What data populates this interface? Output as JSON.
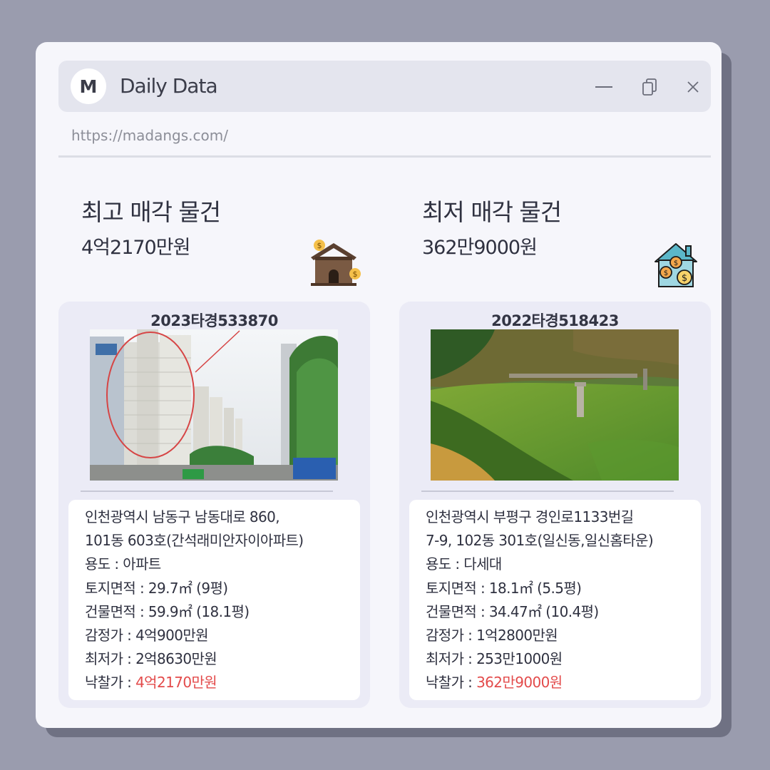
{
  "window": {
    "avatar_letter": "M",
    "title": "Daily Data",
    "url": "https://madangs.com/"
  },
  "highest": {
    "heading": "최고 매각 물건",
    "price": "4억2170만원",
    "icon": "house-money-icon",
    "case_no": "2023타경533870",
    "address_line1": "인천광역시 남동구 남동대로 860,",
    "address_line2": "101동 603호(간석래미안자이아파트)",
    "usage_label": "용도 : ",
    "usage": "아파트",
    "land_area_label": "토지면적 : ",
    "land_area": "29.7㎡ (9평)",
    "building_area_label": "건물면적 : ",
    "building_area": "59.9㎡ (18.1평)",
    "appraisal_label": "감정가 : ",
    "appraisal": "4억900만원",
    "minimum_label": "최저가 : ",
    "minimum": "2억8630만원",
    "winning_label": "낙찰가 : ",
    "winning": "4억2170만원"
  },
  "lowest": {
    "heading": "최저 매각 물건",
    "price": "362만9000원",
    "icon": "house-coins-icon",
    "case_no": "2022타경518423",
    "address_line1": "인천광역시 부평구 경인로1133번길",
    "address_line2": "7-9, 102동 301호(일신동,일신홈타운)",
    "usage_label": "용도 : ",
    "usage": "다세대",
    "land_area_label": "토지면적 : ",
    "land_area": "18.1㎡ (5.5평)",
    "building_area_label": "건물면적 : ",
    "building_area": "34.47㎡ (10.4평)",
    "appraisal_label": "감정가 : ",
    "appraisal": "1억2800만원",
    "minimum_label": "최저가 : ",
    "minimum": "253만1000원",
    "winning_label": "낙찰가 : ",
    "winning": "362만9000원"
  },
  "colors": {
    "background": "#9a9cae",
    "window": "#f6f6fb",
    "titlebar": "#e4e5ee",
    "card": "#ebebf6",
    "highlight": "#e34b4b"
  }
}
